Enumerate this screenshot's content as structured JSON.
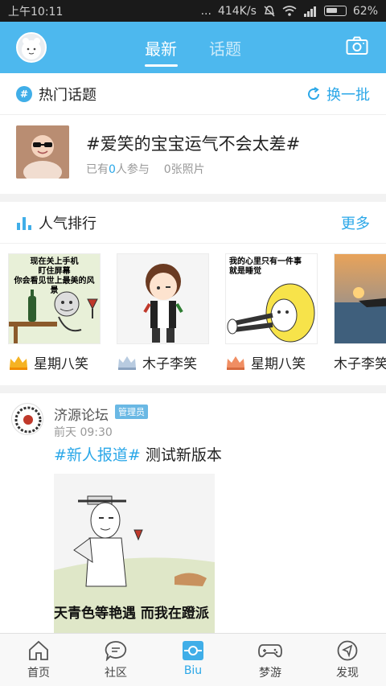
{
  "status_bar": {
    "time": "上午10:11",
    "dots": "...",
    "speed": "414K/s",
    "battery_pct": "62%",
    "battery_level": 0.62
  },
  "header": {
    "tabs": [
      {
        "label": "最新",
        "active": true
      },
      {
        "label": "话题",
        "active": false
      }
    ],
    "avatar_icon": "avatar-icon",
    "camera_icon": "camera-icon"
  },
  "hot_topics": {
    "title": "热门话题",
    "action": "换一批",
    "topic": {
      "title": "#爱笑的宝宝运气不会太差#",
      "participants_prefix": "已有",
      "participants_count": "0",
      "participants_suffix": "人参与",
      "photos": "0张照片"
    }
  },
  "popularity": {
    "title": "人气排行",
    "more": "更多",
    "items": [
      {
        "caption": "现在关上手机\n盯住屏幕\n你会看见世上最美的风景",
        "name": "星期八笑",
        "crown": "gold"
      },
      {
        "caption": "",
        "name": "木子李笑",
        "crown": "silver"
      },
      {
        "caption": "我的心里只有一件事\n就是睡觉",
        "name": "星期八笑",
        "crown": "bronze"
      },
      {
        "caption": "",
        "name": "木子李笑",
        "crown": "none"
      }
    ]
  },
  "post": {
    "user": "济源论坛",
    "badge": "管理员",
    "time": "前天 09:30",
    "tag": "#新人报道#",
    "text": " 测试新版本",
    "image_caption": "天青色等艳遇  而我在蹬派"
  },
  "bottom_nav": [
    {
      "label": "首页",
      "icon": "home-icon",
      "active": false
    },
    {
      "label": "社区",
      "icon": "chat-icon",
      "active": false
    },
    {
      "label": "Biu",
      "icon": "biu-icon",
      "active": true
    },
    {
      "label": "梦游",
      "icon": "gamepad-icon",
      "active": false
    },
    {
      "label": "发现",
      "icon": "compass-icon",
      "active": false
    }
  ],
  "colors": {
    "brand": "#4db8ee",
    "accent": "#2aa7e8"
  }
}
